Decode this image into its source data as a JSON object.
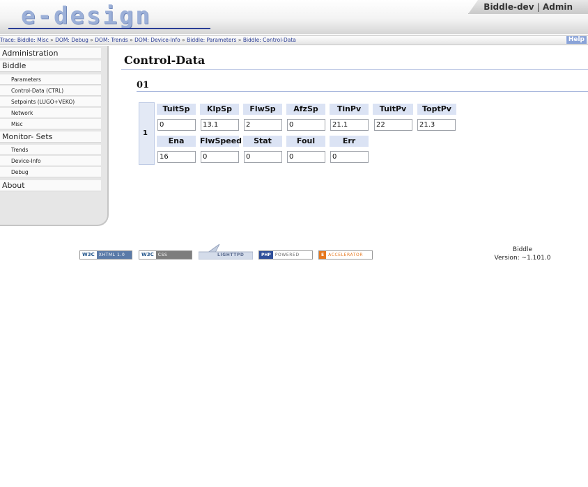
{
  "header": {
    "logo": "e-design",
    "user": "Biddle-dev",
    "separator": "|",
    "role": "Admin"
  },
  "trace": {
    "prefix": "Trace:",
    "items": [
      "Biddle: Misc",
      "DOM: Debug",
      "DOM: Trends",
      "DOM: Device-Info",
      "Biddle: Parameters",
      "Biddle: Control-Data"
    ],
    "arrow": "»",
    "help": "Help"
  },
  "sidebar": {
    "items": [
      {
        "label": "Administration",
        "level": 1
      },
      {
        "label": "Biddle",
        "level": 1
      },
      {
        "label": "Parameters",
        "level": 2
      },
      {
        "label": "Control-Data (CTRL)",
        "level": 2
      },
      {
        "label": "Setpoints (LUGO+VEKO)",
        "level": 2
      },
      {
        "label": "Network",
        "level": 2
      },
      {
        "label": "Misc",
        "level": 2
      },
      {
        "label": "Monitor- Sets",
        "level": 1
      },
      {
        "label": "Trends",
        "level": 2
      },
      {
        "label": "Device-Info",
        "level": 2
      },
      {
        "label": "Debug",
        "level": 2
      },
      {
        "label": "About",
        "level": 1
      }
    ]
  },
  "main": {
    "title": "Control-Data",
    "section": "01",
    "device": "1",
    "row1": {
      "headers": [
        "TuitSp",
        "KlpSp",
        "FlwSp",
        "AfzSp",
        "TinPv",
        "TuitPv",
        "ToptPv"
      ],
      "values": [
        "0",
        "13.1",
        "2",
        "0",
        "21.1",
        "22",
        "21.3"
      ]
    },
    "row2": {
      "headers": [
        "Ena",
        "FlwSpeed",
        "Stat",
        "Foul",
        "Err"
      ],
      "values": [
        "16",
        "0",
        "0",
        "0",
        "0"
      ]
    }
  },
  "footer": {
    "badges": [
      {
        "left": "W3C",
        "right": "XHTML 1.0"
      },
      {
        "left": "W3C",
        "right": "CSS"
      },
      {
        "left": "",
        "right": "LIGHTTPD"
      },
      {
        "left": "PHP",
        "right": "POWERED"
      },
      {
        "left": "E",
        "right": "ACCELERATOR"
      }
    ],
    "app": "Biddle",
    "version": "Version: ~1.101.0"
  }
}
